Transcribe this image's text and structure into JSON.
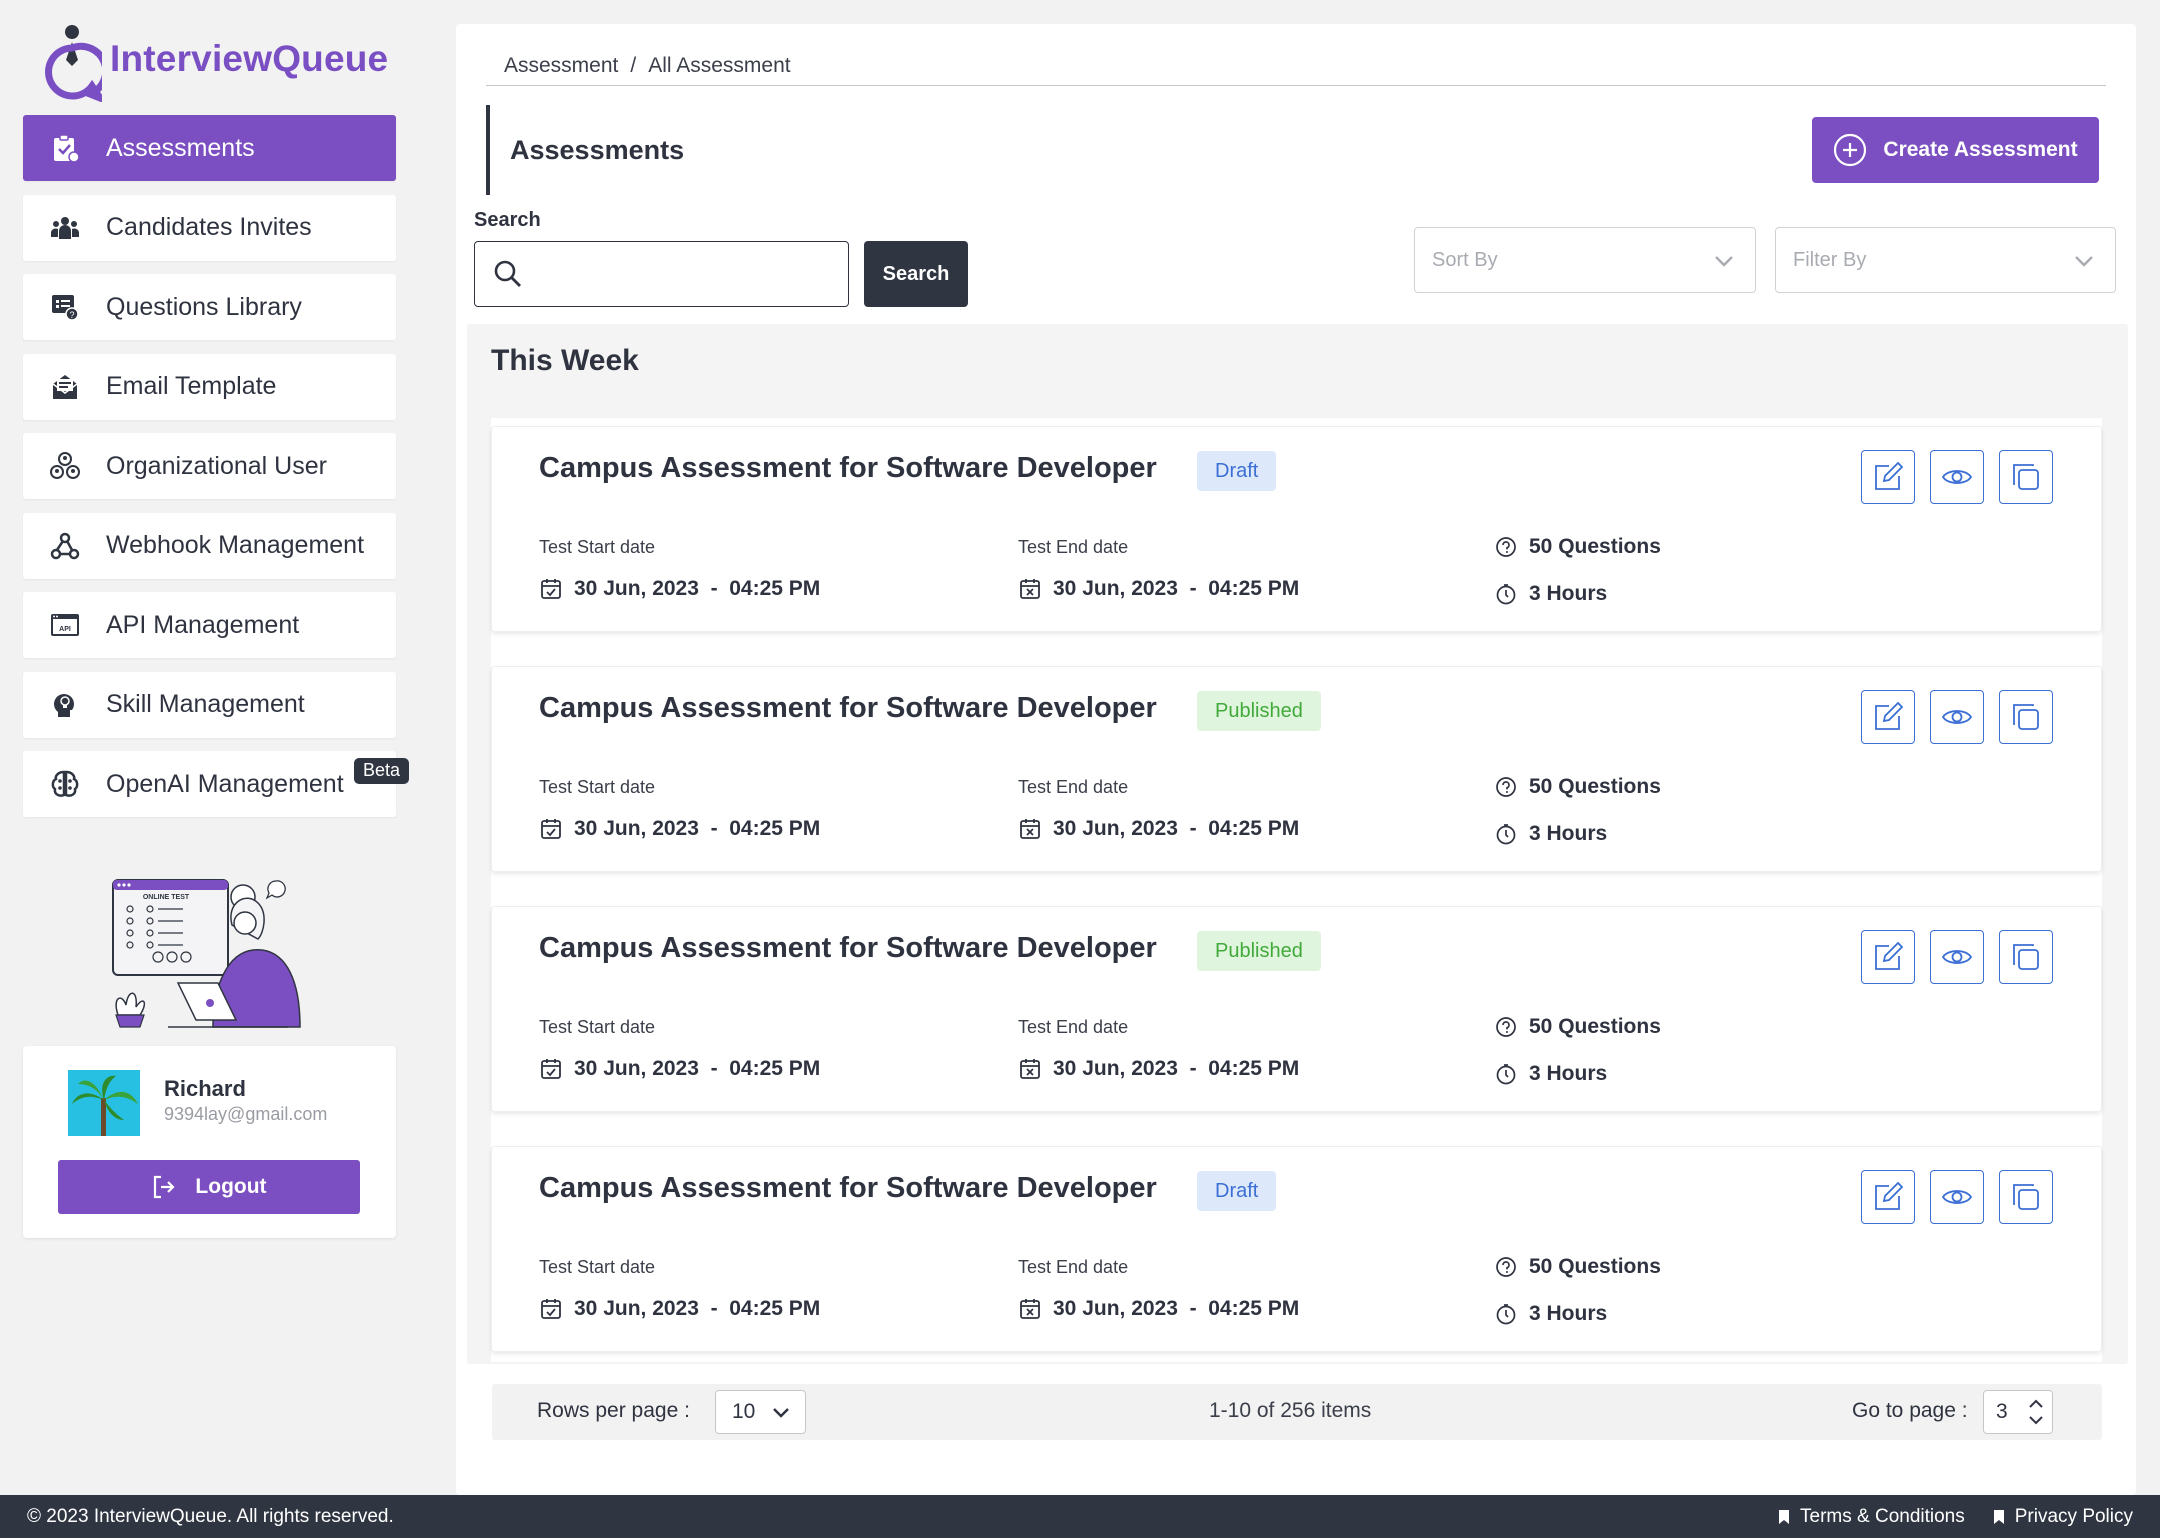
{
  "app": {
    "name": "InterviewQueue"
  },
  "colors": {
    "brand": "#7b4fc1",
    "dark": "#2f3541",
    "draft": "#3c6fd4",
    "published": "#42a93b"
  },
  "sidebar": {
    "items": [
      {
        "label": "Assessments",
        "icon": "clipboard-icon",
        "active": true
      },
      {
        "label": "Candidates Invites",
        "icon": "users-icon"
      },
      {
        "label": "Questions Library",
        "icon": "question-list-icon"
      },
      {
        "label": "Email Template",
        "icon": "envelope-icon"
      },
      {
        "label": "Organizational User",
        "icon": "org-users-icon"
      },
      {
        "label": "Webhook Management",
        "icon": "webhook-icon"
      },
      {
        "label": "API Management",
        "icon": "api-icon"
      },
      {
        "label": "Skill Management",
        "icon": "bulb-head-icon"
      },
      {
        "label": "OpenAI Management",
        "icon": "brain-icon",
        "badge": "Beta"
      }
    ],
    "illustration": {
      "caption": "ONLINE TEST"
    }
  },
  "user": {
    "name": "Richard",
    "email": "9394lay@gmail.com",
    "logout_label": "Logout"
  },
  "breadcrumb": {
    "root": "Assessment",
    "separator": "/",
    "current": "All Assessment"
  },
  "page": {
    "title": "Assessments",
    "create_label": "Create Assessment"
  },
  "search": {
    "label": "Search",
    "value": "",
    "button_label": "Search"
  },
  "sort": {
    "placeholder": "Sort By"
  },
  "filter": {
    "placeholder": "Filter By"
  },
  "group": {
    "title": "This Week"
  },
  "labels": {
    "start": "Test Start date",
    "end": "Test End date"
  },
  "assessments": [
    {
      "title": "Campus Assessment for Software Developer",
      "status": "Draft",
      "status_type": "draft",
      "start": "30 Jun, 2023  -  04:25 PM",
      "end": "30 Jun, 2023  -  04:25 PM",
      "questions": "50 Questions",
      "duration": "3 Hours"
    },
    {
      "title": "Campus Assessment for Software Developer",
      "status": "Published",
      "status_type": "published",
      "start": "30 Jun, 2023  -  04:25 PM",
      "end": "30 Jun, 2023  -  04:25 PM",
      "questions": "50 Questions",
      "duration": "3 Hours"
    },
    {
      "title": "Campus Assessment for Software Developer",
      "status": "Published",
      "status_type": "published",
      "start": "30 Jun, 2023  -  04:25 PM",
      "end": "30 Jun, 2023  -  04:25 PM",
      "questions": "50 Questions",
      "duration": "3 Hours"
    },
    {
      "title": "Campus Assessment for Software Developer",
      "status": "Draft",
      "status_type": "draft",
      "start": "30 Jun, 2023  -  04:25 PM",
      "end": "30 Jun, 2023  -  04:25 PM",
      "questions": "50 Questions",
      "duration": "3 Hours"
    }
  ],
  "pagination": {
    "rows_label": "Rows per page :",
    "rows_value": "10",
    "summary": "1-10 of 256 items",
    "goto_label": "Go to page :",
    "goto_value": "3"
  },
  "footer": {
    "copyright": "© 2023 InterviewQueue. All rights reserved.",
    "terms": "Terms & Conditions",
    "privacy": "Privacy Policy"
  }
}
